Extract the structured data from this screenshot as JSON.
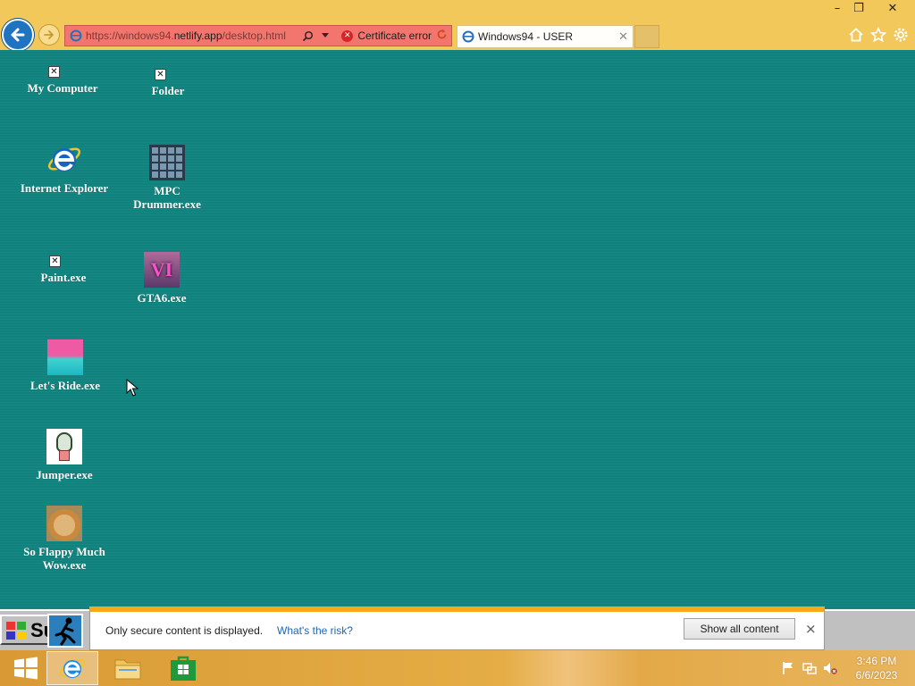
{
  "browser": {
    "address": {
      "url_scheme_part": "https://windows94.",
      "url_domain_part": "netlify.app",
      "url_path_part": "/desktop.html",
      "cert_error_text": "Certificate error"
    },
    "tab": {
      "title": "Windows94 - USER"
    }
  },
  "desktop": {
    "icons": [
      {
        "label": "My Computer"
      },
      {
        "label": "Folder"
      },
      {
        "label": "Internet Explorer"
      },
      {
        "label": "MPC Drummer.exe"
      },
      {
        "label": "Paint.exe"
      },
      {
        "label": "GTA6.exe"
      },
      {
        "label": "Let's Ride.exe"
      },
      {
        "label": "Jumper.exe"
      },
      {
        "label": "So Flappy Much Wow.exe"
      }
    ],
    "broken_glyph": "✕",
    "gta_badge": "VI"
  },
  "w94": {
    "start_label": "Su"
  },
  "notification": {
    "message": "Only secure content is displayed.",
    "risk_link": "What's the risk?",
    "show_button": "Show all content",
    "close_glyph": "×"
  },
  "taskbar": {
    "time": "3:46 PM",
    "date": "6/6/2023"
  },
  "colors": {
    "desktop_bg": "#11847f",
    "chrome_bg": "#f2c85a",
    "address_error": "#f2766e",
    "notify_accent": "#f7a81b",
    "ie_blue": "#1f74c2"
  },
  "window_controls": {
    "minimize": "–",
    "restore": "❐",
    "close": "✕"
  },
  "icons": {
    "back": "back-arrow-icon",
    "forward": "forward-arrow-icon",
    "home": "home-icon",
    "favorites": "star-icon",
    "tools": "gear-icon"
  }
}
